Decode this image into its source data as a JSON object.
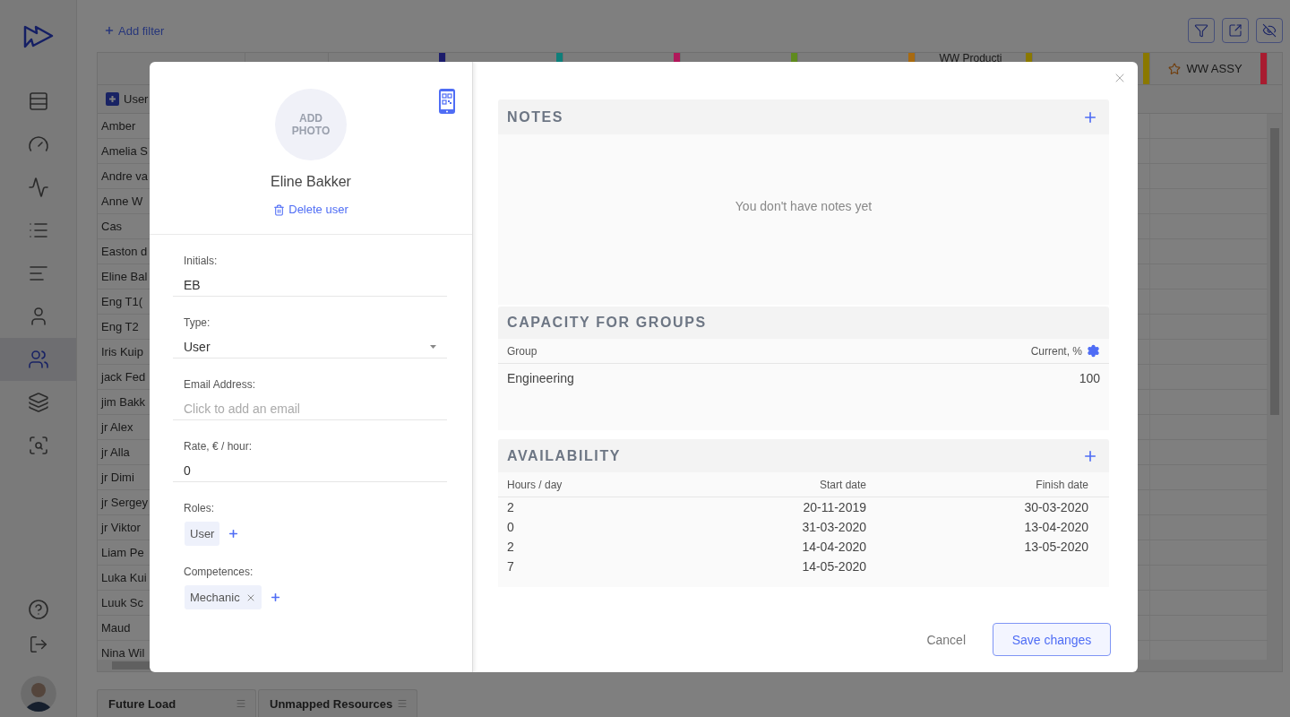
{
  "sidebar": {
    "items": [
      {
        "selected": false
      },
      {
        "selected": false
      },
      {
        "selected": false
      },
      {
        "selected": false
      },
      {
        "selected": false
      },
      {
        "selected": false
      },
      {
        "selected": true
      },
      {
        "selected": false
      },
      {
        "selected": false
      }
    ]
  },
  "toolbar": {
    "add_filter": "Add filter"
  },
  "table": {
    "columns": [
      {
        "color": "#1c1c6b",
        "starred": false
      },
      {
        "color": "#0f7f7a",
        "starred": false
      },
      {
        "color": "#b0185a",
        "starred": false
      },
      {
        "color": "#5f8a1e",
        "starred": false
      },
      {
        "color": "#a86a10",
        "starred": false
      },
      {
        "label": "WW Producti",
        "color": "#8a7800",
        "starred": false
      },
      {
        "color": "#8a7800",
        "starred": false
      },
      {
        "label": "WW ASSY",
        "color": "#a81c30",
        "starred": true
      }
    ],
    "user_header": "User",
    "rows": [
      {
        "name": "Amber"
      },
      {
        "name": "Amelia S"
      },
      {
        "name": "Andre va"
      },
      {
        "name": "Anne W"
      },
      {
        "name": "Cas"
      },
      {
        "name": "Easton d"
      },
      {
        "name": "Eline Bal"
      },
      {
        "name": "Eng T1("
      },
      {
        "name": "Eng T2"
      },
      {
        "name": "Iris Kuip"
      },
      {
        "name": "jack Fed"
      },
      {
        "name": "jim Bakk"
      },
      {
        "name": "jr Alex"
      },
      {
        "name": "jr Alla"
      },
      {
        "name": "jr Dimi"
      },
      {
        "name": "jr Sergey"
      },
      {
        "name": "jr Viktor"
      },
      {
        "name": "Liam Pe"
      },
      {
        "name": "Luka Kui"
      },
      {
        "name": "Luuk Sc"
      },
      {
        "name": "Maud"
      },
      {
        "name": "Nina Wil"
      }
    ]
  },
  "bottom_tabs": [
    {
      "label": "Future Load"
    },
    {
      "label": "Unmapped Resources"
    }
  ],
  "modal": {
    "profile": {
      "photo_placeholder": "ADD PHOTO",
      "name": "Eline Bakker",
      "delete_link": "Delete user"
    },
    "fields": [
      {
        "kind": "text",
        "label": "Initials:",
        "value": "EB"
      },
      {
        "kind": "select",
        "label": "Type:",
        "value": "User"
      },
      {
        "kind": "text",
        "label": "Email Address:",
        "placeholder": "Click to add an email"
      },
      {
        "kind": "text",
        "label": "Rate, € / hour:",
        "value": "0"
      }
    ],
    "roles": {
      "label": "Roles:",
      "chips": [
        {
          "text": "User",
          "removable": false
        }
      ]
    },
    "competences": {
      "label": "Competences:",
      "chips": [
        {
          "text": "Mechanic",
          "removable": true
        }
      ]
    },
    "notes": {
      "title": "NOTES",
      "empty_text": "You don't have notes yet"
    },
    "capacity": {
      "title": "CAPACITY FOR GROUPS",
      "columns": [
        "Group",
        "Current, %"
      ],
      "rows": [
        {
          "group": "Engineering",
          "current": "100"
        }
      ]
    },
    "availability": {
      "title": "AVAILABILITY",
      "columns": [
        "Hours / day",
        "Start date",
        "Finish date"
      ],
      "rows": [
        {
          "hours": "2",
          "start": "20-11-2019",
          "finish": "30-03-2020"
        },
        {
          "hours": "0",
          "start": "31-03-2020",
          "finish": "13-04-2020"
        },
        {
          "hours": "2",
          "start": "14-04-2020",
          "finish": "13-05-2020"
        },
        {
          "hours": "7",
          "start": "14-05-2020"
        }
      ]
    },
    "buttons": {
      "cancel": "Cancel",
      "save": "Save changes"
    }
  }
}
